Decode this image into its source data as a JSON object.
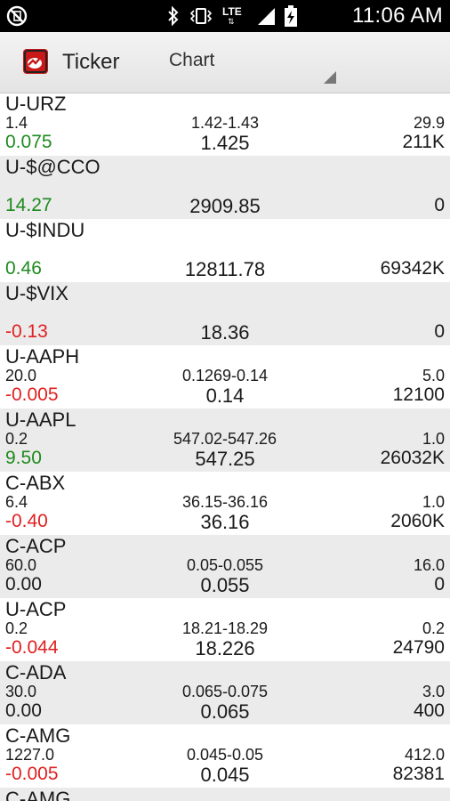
{
  "status_bar": {
    "time": "11:06 AM",
    "network": "LTE",
    "icons": [
      "no-sim-icon",
      "bluetooth-icon",
      "vibrate-icon",
      "signal-icon",
      "battery-charging-icon"
    ]
  },
  "app_bar": {
    "title": "Ticker",
    "view_selector": "Chart"
  },
  "quotes": [
    {
      "symbol": "U-URZ",
      "prev": "1.4",
      "range": "1.42-1.43",
      "vol_small": "29.9",
      "change": "0.075",
      "trend": "up",
      "last": "1.425",
      "volume": "211K"
    },
    {
      "symbol": "U-$@CCO",
      "prev": "",
      "range": "",
      "vol_small": "",
      "change": "14.27",
      "trend": "up",
      "last": "2909.85",
      "volume": "0"
    },
    {
      "symbol": "U-$INDU",
      "prev": "",
      "range": "",
      "vol_small": "",
      "change": "0.46",
      "trend": "up",
      "last": "12811.78",
      "volume": "69342K"
    },
    {
      "symbol": "U-$VIX",
      "prev": "",
      "range": "",
      "vol_small": "",
      "change": "-0.13",
      "trend": "down",
      "last": "18.36",
      "volume": "0"
    },
    {
      "symbol": "U-AAPH",
      "prev": "20.0",
      "range": "0.1269-0.14",
      "vol_small": "5.0",
      "change": "-0.005",
      "trend": "down",
      "last": "0.14",
      "volume": "12100"
    },
    {
      "symbol": "U-AAPL",
      "prev": "0.2",
      "range": "547.02-547.26",
      "vol_small": "1.0",
      "change": "9.50",
      "trend": "up",
      "last": "547.25",
      "volume": "26032K"
    },
    {
      "symbol": "C-ABX",
      "prev": "6.4",
      "range": "36.15-36.16",
      "vol_small": "1.0",
      "change": "-0.40",
      "trend": "down",
      "last": "36.16",
      "volume": "2060K"
    },
    {
      "symbol": "C-ACP",
      "prev": "60.0",
      "range": "0.05-0.055",
      "vol_small": "16.0",
      "change": "0.00",
      "trend": "flat",
      "last": "0.055",
      "volume": "0"
    },
    {
      "symbol": "U-ACP",
      "prev": "0.2",
      "range": "18.21-18.29",
      "vol_small": "0.2",
      "change": "-0.044",
      "trend": "down",
      "last": "18.226",
      "volume": "24790"
    },
    {
      "symbol": "C-ADA",
      "prev": "30.0",
      "range": "0.065-0.075",
      "vol_small": "3.0",
      "change": "0.00",
      "trend": "flat",
      "last": "0.065",
      "volume": "400"
    },
    {
      "symbol": "C-AMG",
      "prev": "1227.0",
      "range": "0.045-0.05",
      "vol_small": "412.0",
      "change": "-0.005",
      "trend": "down",
      "last": "0.045",
      "volume": "82381"
    }
  ],
  "partial_row": {
    "symbol": "C-AMG"
  },
  "colors": {
    "up": "#1e8a1e",
    "down": "#e02020",
    "row_alt": "#ebebeb"
  }
}
